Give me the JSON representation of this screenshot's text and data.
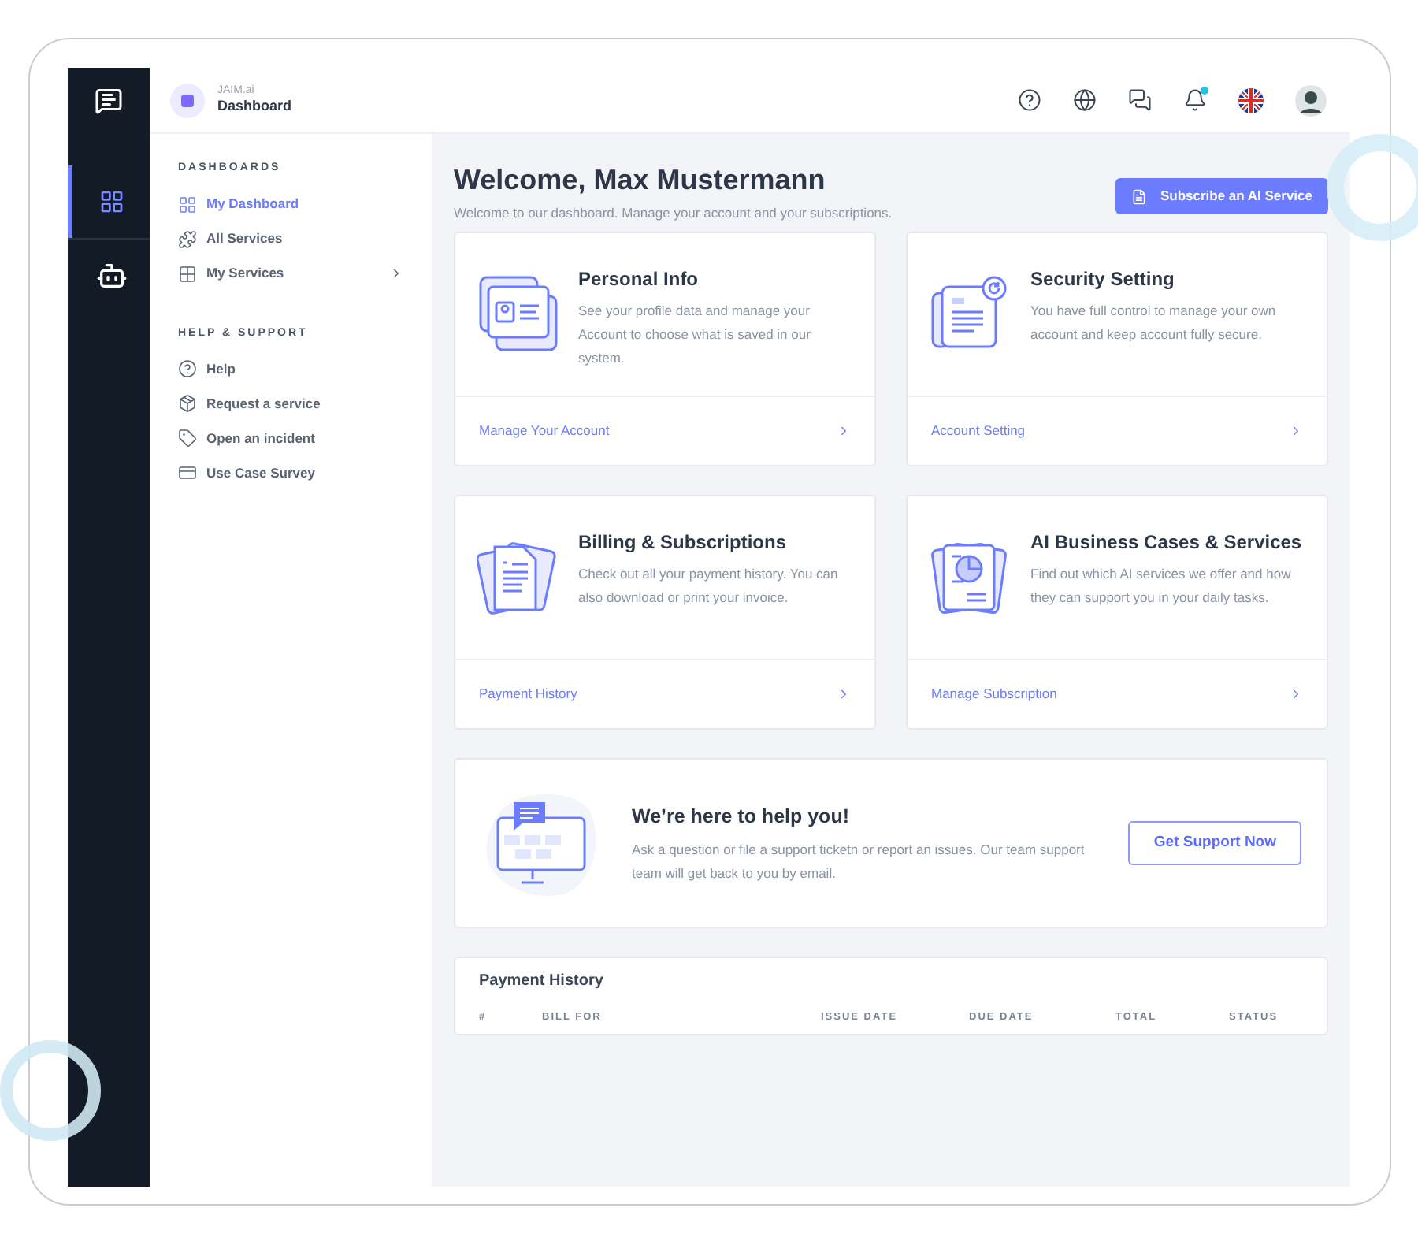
{
  "rail": {
    "nav": [
      {
        "kind": "grid",
        "selected": true
      },
      {
        "kind": "robot",
        "selected": false
      }
    ]
  },
  "topbar": {
    "app_name": "JAIM.ai",
    "page": "Dashboard",
    "notification_dot": true
  },
  "sidebar": {
    "sections": [
      {
        "title": "DASHBOARDS",
        "items": [
          {
            "label": "My Dashboard",
            "kind": "grid",
            "selected": true,
            "submenu": false
          },
          {
            "label": "All Services",
            "kind": "puzzle",
            "selected": false,
            "submenu": false
          },
          {
            "label": "My Services",
            "kind": "apps",
            "selected": false,
            "submenu": true
          }
        ]
      },
      {
        "title": "HELP & SUPPORT",
        "items": [
          {
            "label": "Help",
            "kind": "help",
            "selected": false,
            "submenu": false
          },
          {
            "label": "Request a service",
            "kind": "package",
            "selected": false,
            "submenu": false
          },
          {
            "label": "Open an incident",
            "kind": "tag",
            "selected": false,
            "submenu": false
          },
          {
            "label": "Use Case Survey",
            "kind": "survey",
            "selected": false,
            "submenu": false
          }
        ]
      }
    ]
  },
  "header": {
    "title": "Welcome, Max Mustermann",
    "subtitle": "Welcome to our dashboard. Manage your account and your subscriptions.",
    "button": "Subscribe an AI Service"
  },
  "cards": [
    {
      "kind": "profile",
      "title": "Personal Info",
      "text": "See your profile data and manage your Account to choose what is saved in our system.",
      "link": "Manage Your Account"
    },
    {
      "kind": "security",
      "title": "Security Setting",
      "text": "You have full control to manage your own account and keep account fully secure.",
      "link": "Account Setting"
    },
    {
      "kind": "billing",
      "title": "Billing & Subscriptions",
      "text": "Check out all your payment history. You can also download or print your invoice.",
      "link": "Payment History"
    },
    {
      "kind": "business",
      "title": "AI Business Cases & Services",
      "text": "Find out which AI services we offer and how they can support you in your daily tasks.",
      "link": "Manage Subscription"
    }
  ],
  "help": {
    "title": "We’re here to help you!",
    "text": "Ask a question or file a support ticketn or report an issues. Our team support team will get back to you by email.",
    "button": "Get Support Now"
  },
  "payment_history": {
    "title": "Payment History",
    "columns": [
      "#",
      "BILL FOR",
      "ISSUE DATE",
      "DUE DATE",
      "TOTAL",
      "STATUS"
    ]
  }
}
